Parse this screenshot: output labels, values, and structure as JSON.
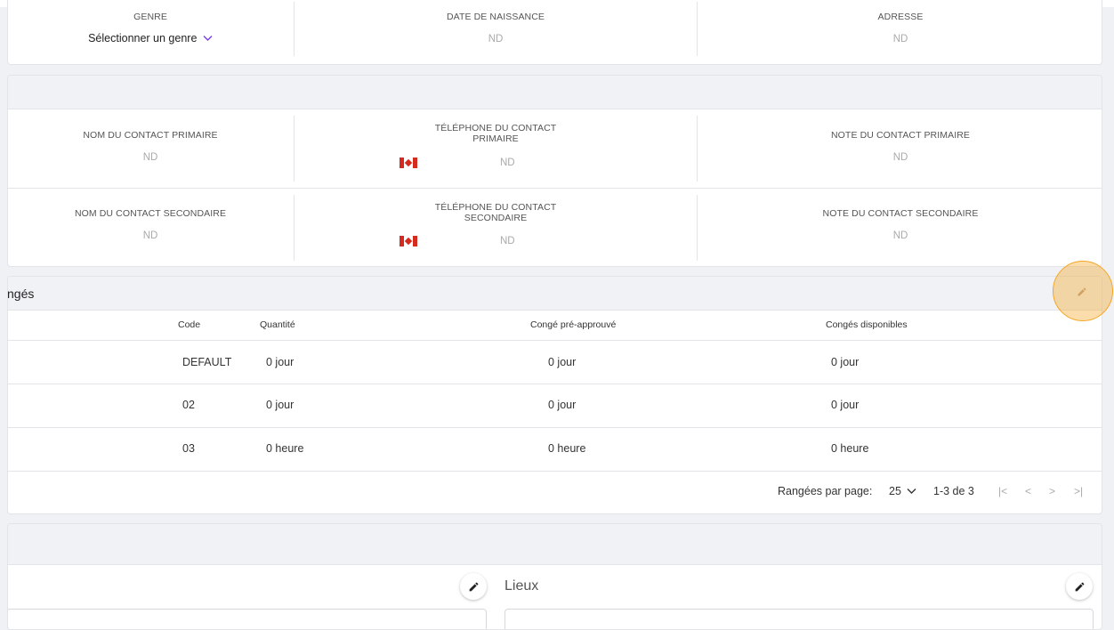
{
  "identity": {
    "genre_label": "GENRE",
    "genre_value": "Sélectionner un genre",
    "dob_label": "DATE DE NAISSANCE",
    "dob_value": "ND",
    "address_label": "ADRESSE",
    "address_value": "ND"
  },
  "contacts": {
    "primary": {
      "name_label": "NOM DU CONTACT PRIMAIRE",
      "name_value": "ND",
      "phone_label_line1": "TÉLÉPHONE DU CONTACT",
      "phone_label_line2": "PRIMAIRE",
      "phone_value": "ND",
      "note_label": "NOTE DU CONTACT PRIMAIRE",
      "note_value": "ND"
    },
    "secondary": {
      "name_label": "NOM DU CONTACT SECONDAIRE",
      "name_value": "ND",
      "phone_label_line1": "TÉLÉPHONE DU CONTACT",
      "phone_label_line2": "SECONDAIRE",
      "phone_value": "ND",
      "note_label": "NOTE DU CONTACT SECONDAIRE",
      "note_value": "ND"
    }
  },
  "leaves": {
    "title": "ngés",
    "columns": {
      "code": "Code",
      "quantity": "Quantité",
      "preapproved": "Congé pré-approuvé",
      "available": "Congés disponibles"
    },
    "rows": [
      {
        "code": "DEFAULT",
        "quantity": "0 jour",
        "preapproved": "0 jour",
        "available": "0 jour"
      },
      {
        "code": "02",
        "quantity": "0 jour",
        "preapproved": "0 jour",
        "available": "0 jour"
      },
      {
        "code": "03",
        "quantity": "0 heure",
        "preapproved": "0 heure",
        "available": "0 heure"
      }
    ],
    "pagination": {
      "rows_per_page_label": "Rangées par page:",
      "rows_per_page_value": "25",
      "range": "1-3 de 3"
    }
  },
  "locations": {
    "title": "Lieux"
  },
  "colors": {
    "highlight": "#f5a623",
    "flag_red": "#d52b1e",
    "accent": "#7a3cf0"
  }
}
